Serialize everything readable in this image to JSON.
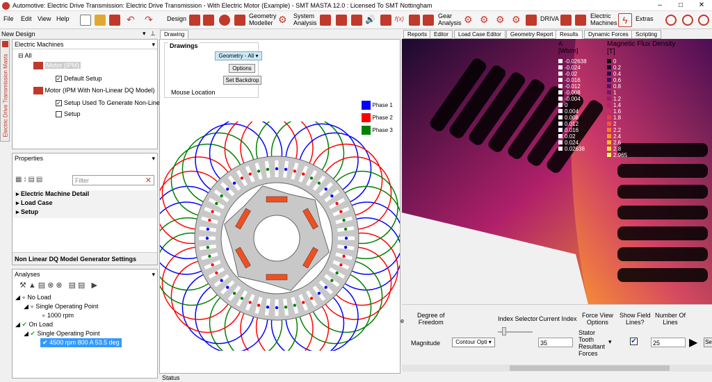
{
  "window": {
    "title": "Automotive: Electric Drive Transmission: Electric Drive Transmission - With Electric Motor (Example) - SMT MASTA 12.0 : Licensed To SMT Nottingham",
    "min": "–",
    "max": "□",
    "close": "✕"
  },
  "menu": {
    "file": "File",
    "edit": "Edit",
    "view": "View",
    "help": "Help"
  },
  "ribbon": {
    "design": "Design",
    "geometry_modeller": "Geometry\nModeller",
    "system_analysis": "System\nAnalysis",
    "gear_analysis": "Gear\nAnalysis",
    "driva": "DRIVA",
    "electric_machines": "Electric\nMachines",
    "extras": "Extras",
    "fx": "f(x)"
  },
  "left": {
    "new_design": "New Design",
    "side_tab": "Electric Drive Transmission Masts",
    "dropdown": "Electric Machines",
    "tree": [
      {
        "label": "All"
      },
      {
        "label": "Motor (IPM)"
      },
      {
        "label": "Default Setup"
      },
      {
        "label": "Motor (IPM With Non-Linear DQ Model)"
      },
      {
        "label": "Setup Used To Generate Non-Linear"
      },
      {
        "label": "Setup"
      }
    ]
  },
  "properties": {
    "title": "Properties",
    "filter_placeholder": "Filter",
    "items": [
      "Electric Machine Detail",
      "Load Case",
      "Setup"
    ],
    "footer": "Non Linear DQ Model Generator Settings"
  },
  "analyses": {
    "title": "Analyses",
    "items": [
      "No Load",
      "Single Operating Point",
      "1000 rpm",
      "On Load",
      "Single Operating Point",
      "4500 rpm 800 A 53.5 deg"
    ]
  },
  "drawing": {
    "tab": "Drawing",
    "group": "Drawings",
    "geometry_select": "Geometry - All",
    "options": "Options",
    "set_backdrop": "Set Backdrop",
    "mouse_location": "Mouse Location",
    "legend": [
      {
        "name": "Phase 1",
        "color": "#0000ff"
      },
      {
        "name": "Phase 2",
        "color": "#ff0000"
      },
      {
        "name": "Phase 3",
        "color": "#008000"
      }
    ]
  },
  "right_tabs": [
    "Reports",
    "Editor",
    "Load Case Editor",
    "Geometry Report",
    "Results",
    "Dynamic Forces",
    "Scripting"
  ],
  "results": {
    "a_header": "A\n[Wb/m]",
    "b_header": "Magnetic Flux Density\n[T]",
    "a_values": [
      "-0.02638",
      "-0.024",
      "-0.02",
      "-0.016",
      "-0.012",
      "-0.008",
      "-0.004",
      "0",
      "0.004",
      "0.008",
      "0.012",
      "0.016",
      "0.02",
      "0.024",
      "0.02638"
    ],
    "b_values": [
      "0",
      "0.2",
      "0.4",
      "0.6",
      "0.8",
      "1",
      "1.2",
      "1.4",
      "1.6",
      "1.8",
      "2",
      "2.2",
      "2.4",
      "2.6",
      "2.8",
      "2.965"
    ]
  },
  "controls": {
    "degree_of_freedom": "Degree of\nFreedom",
    "magnitude": "Magnitude",
    "contour": "Contour Opti",
    "index_selector": "Index Selector",
    "current_index": "Current Index",
    "current_index_val": "35",
    "force_view": "Force View\nOptions",
    "force_view_val": "Stator\nTooth\nResultant\nForces",
    "show_field_lines": "Show Field\nLines?",
    "number_of_lines": "Number Of\nLines",
    "number_of_lines_val": "25",
    "se": "Se"
  },
  "status": "Status"
}
